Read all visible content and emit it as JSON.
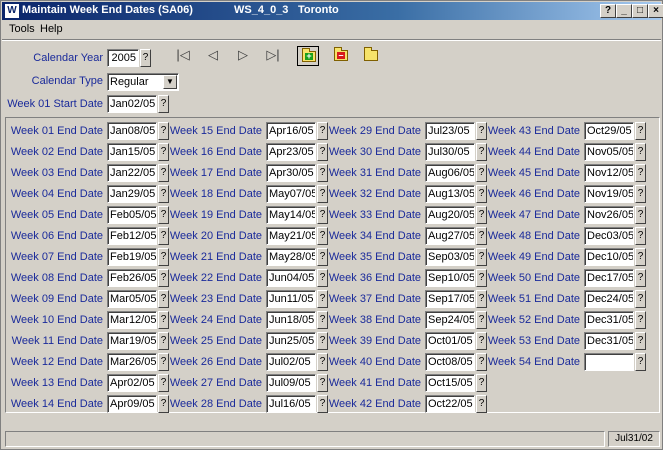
{
  "window": {
    "title": "Maintain Week End Dates (SA06)",
    "workstation": "WS_4_0_3",
    "location": "Toronto",
    "help_glyph": "?",
    "minimize_glyph": "_",
    "maximize_glyph": "□",
    "close_glyph": "×",
    "app_icon_letter": "W"
  },
  "menu": {
    "tools": "Tools",
    "help": "Help"
  },
  "header": {
    "calendar_year_label": "Calendar Year",
    "calendar_year": "2005",
    "calendar_type_label": "Calendar Type",
    "calendar_type": "Regular",
    "week01_start_label": "Week 01 Start Date",
    "week01_start": "Jan02/05",
    "lookup_glyph": "?"
  },
  "nav": {
    "first": "|◁",
    "prev": "◁",
    "next": "▷",
    "last": "▷|"
  },
  "toolbar_icons": [
    "add-folder-icon",
    "remove-folder-icon",
    "open-folder-icon"
  ],
  "weeks": [
    {
      "label": "Week 01 End Date",
      "value": "Jan08/05"
    },
    {
      "label": "Week 02 End Date",
      "value": "Jan15/05"
    },
    {
      "label": "Week 03 End Date",
      "value": "Jan22/05"
    },
    {
      "label": "Week 04 End Date",
      "value": "Jan29/05"
    },
    {
      "label": "Week 05 End Date",
      "value": "Feb05/05"
    },
    {
      "label": "Week 06 End Date",
      "value": "Feb12/05"
    },
    {
      "label": "Week 07 End Date",
      "value": "Feb19/05"
    },
    {
      "label": "Week 08 End Date",
      "value": "Feb26/05"
    },
    {
      "label": "Week 09 End Date",
      "value": "Mar05/05"
    },
    {
      "label": "Week 10 End Date",
      "value": "Mar12/05"
    },
    {
      "label": "Week 11 End Date",
      "value": "Mar19/05"
    },
    {
      "label": "Week 12 End Date",
      "value": "Mar26/05"
    },
    {
      "label": "Week 13 End Date",
      "value": "Apr02/05"
    },
    {
      "label": "Week 14 End Date",
      "value": "Apr09/05"
    },
    {
      "label": "Week 15 End Date",
      "value": "Apr16/05"
    },
    {
      "label": "Week 16 End Date",
      "value": "Apr23/05"
    },
    {
      "label": "Week 17 End Date",
      "value": "Apr30/05"
    },
    {
      "label": "Week 18 End Date",
      "value": "May07/05"
    },
    {
      "label": "Week 19 End Date",
      "value": "May14/05"
    },
    {
      "label": "Week 20 End Date",
      "value": "May21/05"
    },
    {
      "label": "Week 21 End Date",
      "value": "May28/05"
    },
    {
      "label": "Week 22 End Date",
      "value": "Jun04/05"
    },
    {
      "label": "Week 23 End Date",
      "value": "Jun11/05"
    },
    {
      "label": "Week 24 End Date",
      "value": "Jun18/05"
    },
    {
      "label": "Week 25 End Date",
      "value": "Jun25/05"
    },
    {
      "label": "Week 26 End Date",
      "value": "Jul02/05"
    },
    {
      "label": "Week 27 End Date",
      "value": "Jul09/05"
    },
    {
      "label": "Week 28 End Date",
      "value": "Jul16/05"
    },
    {
      "label": "Week 29 End Date",
      "value": "Jul23/05"
    },
    {
      "label": "Week 30 End Date",
      "value": "Jul30/05"
    },
    {
      "label": "Week 31 End Date",
      "value": "Aug06/05"
    },
    {
      "label": "Week 32 End Date",
      "value": "Aug13/05"
    },
    {
      "label": "Week 33 End Date",
      "value": "Aug20/05"
    },
    {
      "label": "Week 34 End Date",
      "value": "Aug27/05"
    },
    {
      "label": "Week 35 End Date",
      "value": "Sep03/05"
    },
    {
      "label": "Week 36 End Date",
      "value": "Sep10/05"
    },
    {
      "label": "Week 37 End Date",
      "value": "Sep17/05"
    },
    {
      "label": "Week 38 End Date",
      "value": "Sep24/05"
    },
    {
      "label": "Week 39 End Date",
      "value": "Oct01/05"
    },
    {
      "label": "Week 40 End Date",
      "value": "Oct08/05"
    },
    {
      "label": "Week 41 End Date",
      "value": "Oct15/05"
    },
    {
      "label": "Week 42 End Date",
      "value": "Oct22/05"
    },
    {
      "label": "Week 43 End Date",
      "value": "Oct29/05"
    },
    {
      "label": "Week 44 End Date",
      "value": "Nov05/05"
    },
    {
      "label": "Week 45 End Date",
      "value": "Nov12/05"
    },
    {
      "label": "Week 46 End Date",
      "value": "Nov19/05"
    },
    {
      "label": "Week 47 End Date",
      "value": "Nov26/05"
    },
    {
      "label": "Week 48 End Date",
      "value": "Dec03/05"
    },
    {
      "label": "Week 49 End Date",
      "value": "Dec10/05"
    },
    {
      "label": "Week 50 End Date",
      "value": "Dec17/05"
    },
    {
      "label": "Week 51 End Date",
      "value": "Dec24/05"
    },
    {
      "label": "Week 52 End Date",
      "value": "Dec31/05"
    },
    {
      "label": "Week 53 End Date",
      "value": "Dec31/05"
    },
    {
      "label": "Week 54 End Date",
      "value": ""
    }
  ],
  "status": {
    "message": "",
    "date": "Jul31/02"
  },
  "colors": {
    "label": "#1a2a9a",
    "title_start": "#0a246a",
    "title_end": "#a6caf0",
    "face": "#d4d0c8"
  }
}
